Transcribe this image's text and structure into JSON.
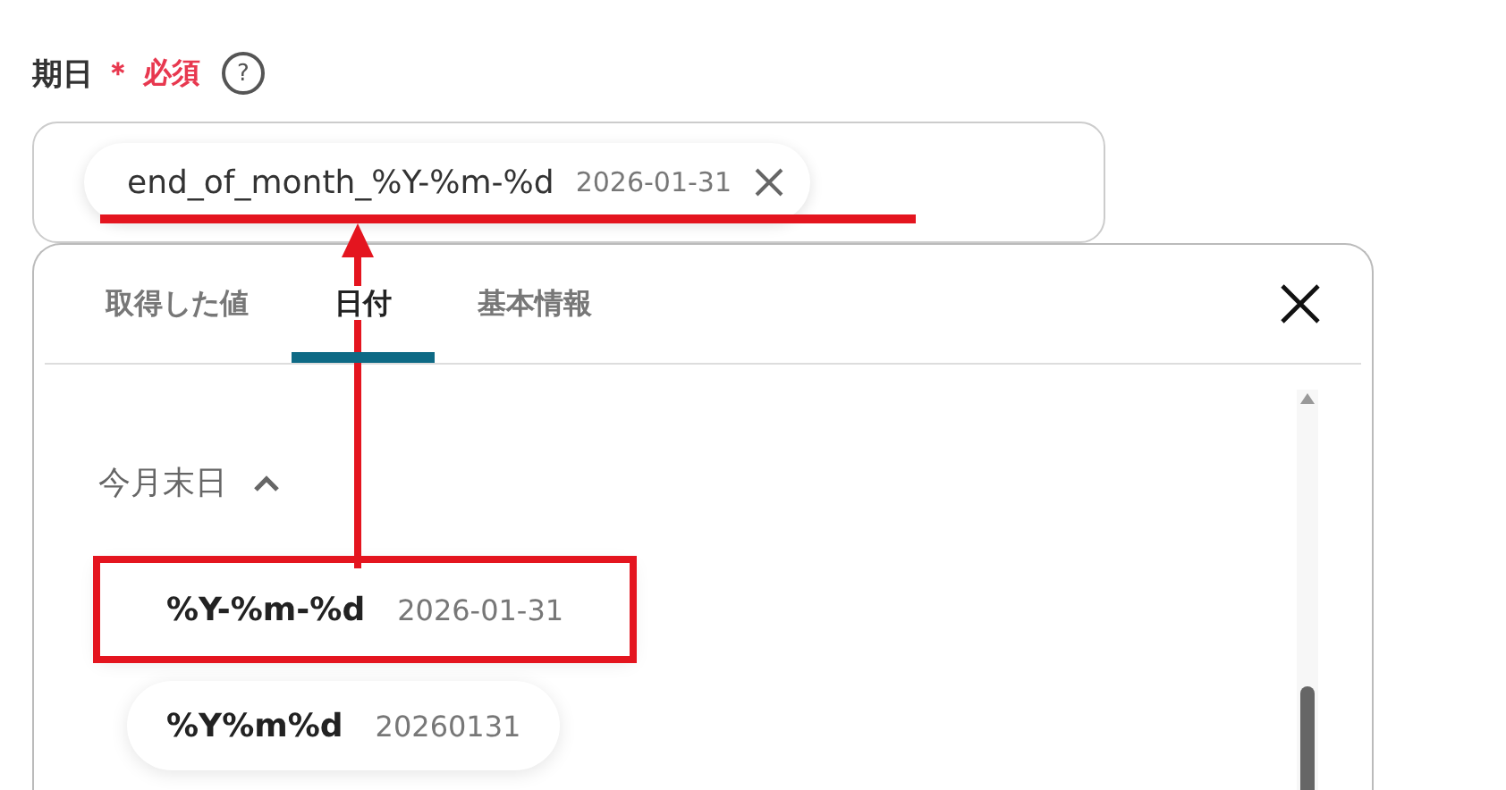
{
  "field": {
    "label": "期日",
    "required_mark": "＊",
    "required_text": "必須",
    "help_icon": "?",
    "chip": {
      "value": "end_of_month_%Y-%m-%d",
      "preview": "2026-01-31"
    }
  },
  "panel": {
    "tabs": [
      {
        "label": "取得した値",
        "selected": false
      },
      {
        "label": "日付",
        "selected": true
      },
      {
        "label": "基本情報",
        "selected": false
      }
    ],
    "section": {
      "title": "今月末日",
      "expanded": true,
      "items": [
        {
          "format": "%Y-%m-%d",
          "preview": "2026-01-31",
          "highlighted": true
        },
        {
          "format": "%Y%m%d",
          "preview": "20260131",
          "highlighted": false
        }
      ]
    }
  }
}
